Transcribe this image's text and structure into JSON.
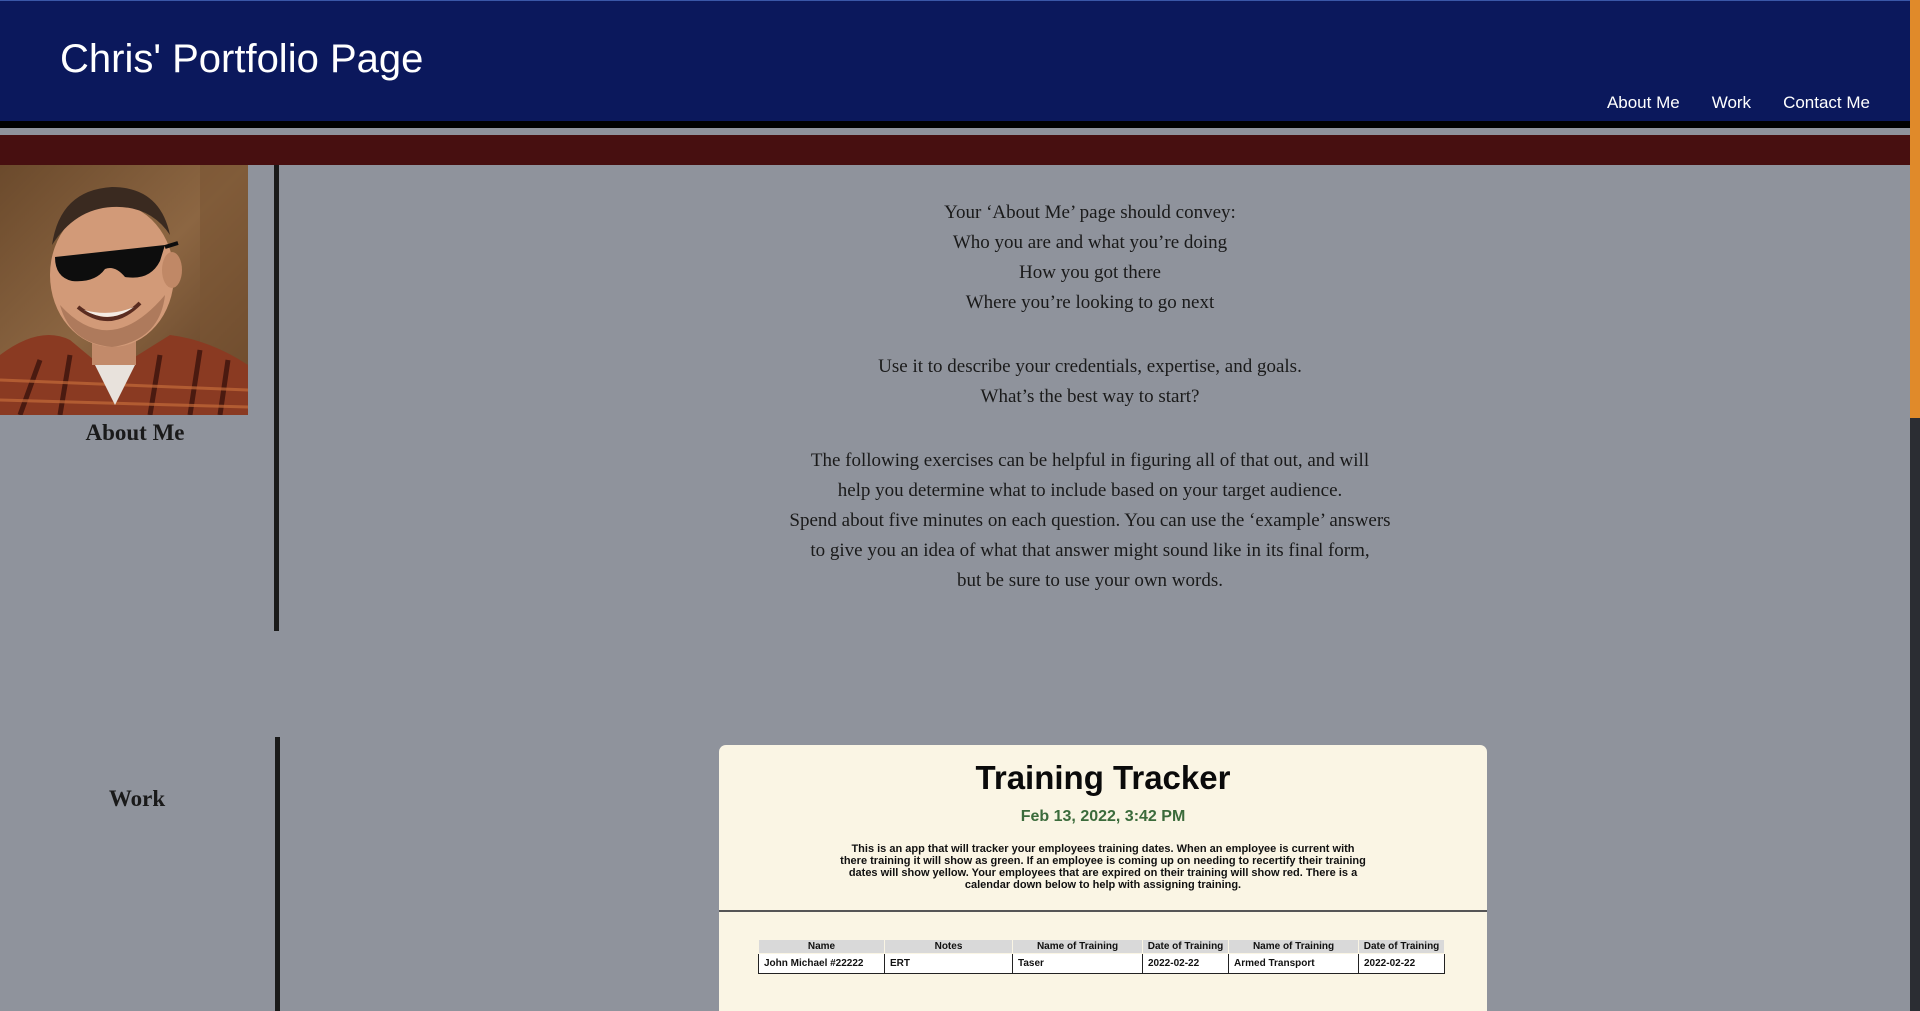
{
  "header": {
    "site_title": "Chris' Portfolio Page",
    "nav": [
      "About Me",
      "Work",
      "Contact Me"
    ]
  },
  "about": {
    "label": "About Me",
    "paragraphs": [
      [
        "Your ‘About Me’ page should convey:",
        "Who you are and what you’re doing",
        "How you got there",
        "Where you’re looking to go next"
      ],
      [
        "Use it to describe your credentials, expertise, and goals.",
        "What’s the best way to start?"
      ],
      [
        "The following exercises can be helpful in figuring all of that out, and will",
        "help you determine what to include based on your target audience.",
        "Spend about five minutes on each question. You can use the ‘example’ answers",
        "to give you an idea of what that answer might sound like in its final form,",
        "but be sure to use your own words."
      ]
    ]
  },
  "work": {
    "label": "Work",
    "tracker": {
      "title": "Training Tracker",
      "date": "Feb 13, 2022, 3:42 PM",
      "description": "This is an app that will tracker your employees training dates. When an employee is current with there training it will show as green. If an employee is coming up on needing to recertify their training dates will show yellow. Your employees that are expired on their training will show red. There is a calendar down below to help with assigning training.",
      "columns": [
        "Name",
        "Notes",
        "Name of Training",
        "Date of Training",
        "Name of Training",
        "Date of Training"
      ],
      "rows": [
        [
          "John Michael #22222",
          "ERT",
          "Taser",
          "2022-02-22",
          "Armed Transport",
          "2022-02-22"
        ]
      ]
    }
  },
  "colors": {
    "header_bg": "#0b185c",
    "accent_bar": "#470f10",
    "page_bg": "#8f939c",
    "card_bg": "#faf5e4",
    "date_green": "#3b6b3b"
  }
}
